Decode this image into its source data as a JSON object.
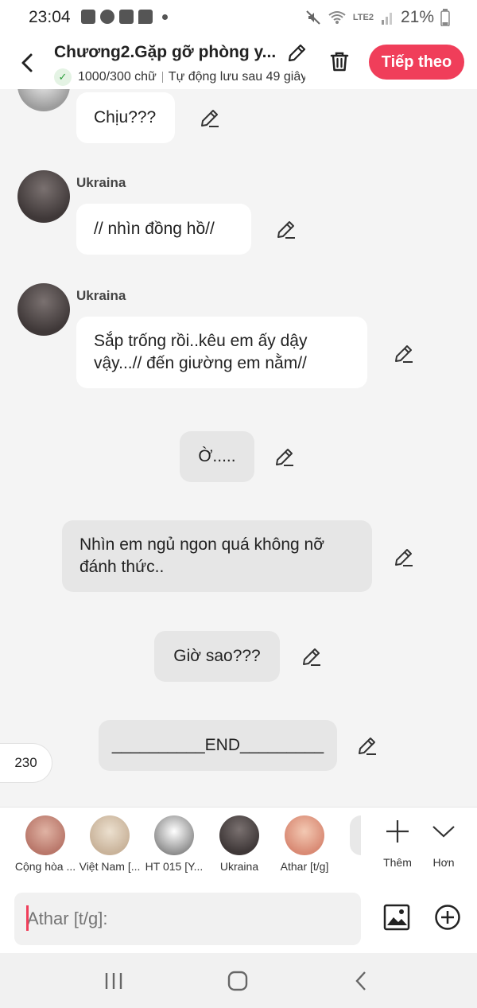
{
  "status_bar": {
    "time": "23:04",
    "battery": "21%",
    "network": "LTE2",
    "icons": [
      "facebook-icon",
      "messenger-icon",
      "facebook-icon",
      "chat-icon",
      "mute-icon",
      "wifi-icon",
      "signal-icon",
      "battery-icon"
    ]
  },
  "header": {
    "title": "Chương2.Gặp gỡ phòng y...",
    "word_count": "1000/300 chữ",
    "autosave": "Tự động lưu sau 49 giây",
    "next_label": "Tiếp theo",
    "accent": "#f03e5a"
  },
  "messages": [
    {
      "sender": "",
      "text": "Chịu???",
      "style": "character"
    },
    {
      "sender": "Ukraina",
      "text": "// nhìn đồng hồ//",
      "style": "character"
    },
    {
      "sender": "Ukraina",
      "text": "Sắp trống rồi..kêu em ấy dậy vậy...// đến giường em nằm//",
      "style": "character"
    },
    {
      "sender": "",
      "text": "Ờ.....",
      "style": "narration"
    },
    {
      "sender": "",
      "text": "Nhìn em ngủ ngon quá không nỡ đánh thức..",
      "style": "narration"
    },
    {
      "sender": "",
      "text": "Giờ sao???",
      "style": "narration"
    },
    {
      "sender": "",
      "text": "__________END_________",
      "style": "narration"
    }
  ],
  "counter": "230",
  "characters": [
    {
      "name": "Cộng hòa ...",
      "color": "#b9776a"
    },
    {
      "name": "Việt Nam [...",
      "color": "#c9b39a"
    },
    {
      "name": "HT 015 [Y...",
      "color": "#d4d4d4"
    },
    {
      "name": "Ukraina",
      "color": "#544b4a"
    },
    {
      "name": "Athar [t/g]",
      "color": "#d98a74"
    }
  ],
  "tools": {
    "add_label": "Thêm",
    "more_label": "Hơn"
  },
  "composer": {
    "placeholder": "Athar [t/g]:"
  }
}
